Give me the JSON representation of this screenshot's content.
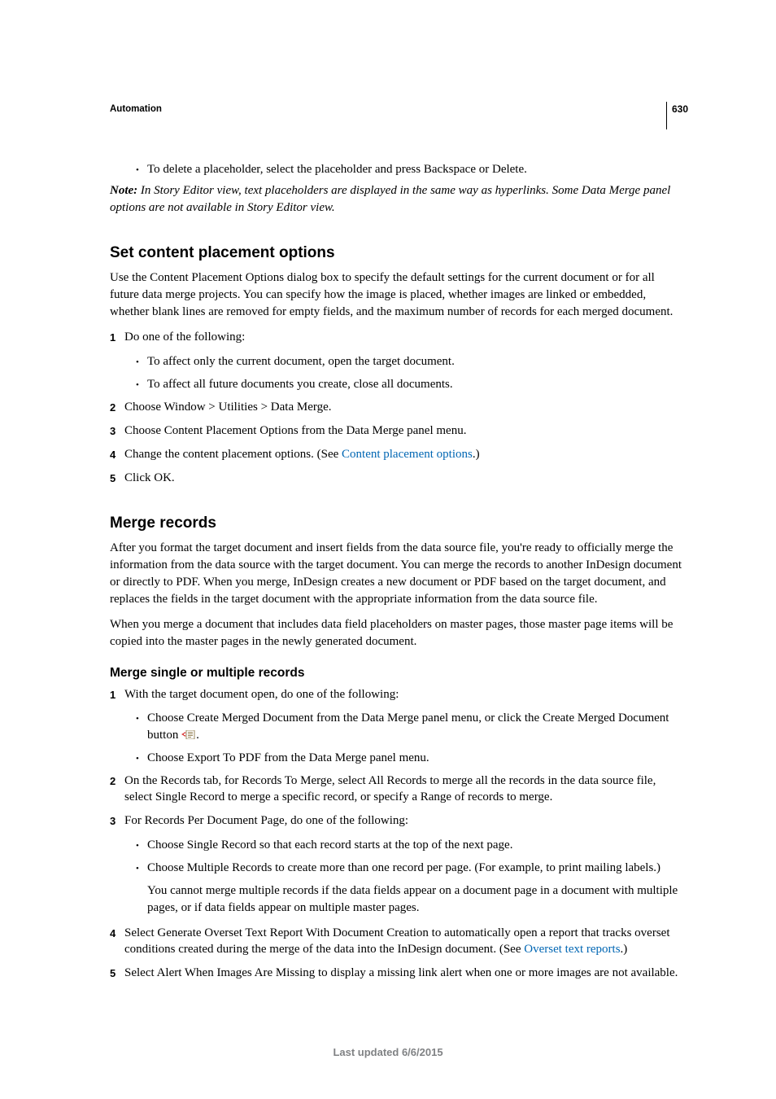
{
  "page_number": "630",
  "running_head": "Automation",
  "intro": {
    "bullet": "To delete a placeholder, select the placeholder and press Backspace or Delete.",
    "note_label": "Note: ",
    "note_text": "In Story Editor view, text placeholders are displayed in the same way as hyperlinks. Some Data Merge panel options are not available in Story Editor view."
  },
  "section1": {
    "title": "Set content placement options",
    "intro": "Use the Content Placement Options dialog box to specify the default settings for the current document or for all future data merge projects. You can specify how the image is placed, whether images are linked or embedded, whether blank lines are removed for empty fields, and the maximum number of records for each merged document.",
    "steps": [
      {
        "num": "1",
        "text": "Do one of the following:",
        "sub": [
          "To affect only the current document, open the target document.",
          "To affect all future documents you create, close all documents."
        ]
      },
      {
        "num": "2",
        "text": "Choose Window > Utilities > Data Merge."
      },
      {
        "num": "3",
        "text": "Choose Content Placement Options from the Data Merge panel menu."
      },
      {
        "num": "4",
        "text_pre": "Change the content placement options. (See ",
        "link": "Content placement options",
        "text_post": ".)"
      },
      {
        "num": "5",
        "text": "Click OK."
      }
    ]
  },
  "section2": {
    "title": "Merge records",
    "para1": "After you format the target document and insert fields from the data source file, you're ready to officially merge the information from the data source with the target document. You can merge the records to another InDesign document or directly to PDF. When you merge, InDesign creates a new document or PDF based on the target document, and replaces the fields in the target document with the appropriate information from the data source file.",
    "para2": "When you merge a document that includes data field placeholders on master pages, those master page items will be copied into the master pages in the newly generated document.",
    "sub_title": "Merge single or multiple records",
    "steps": [
      {
        "num": "1",
        "text": "With the target document open, do one of the following:",
        "sub": [
          {
            "pre": "Choose Create Merged Document from the Data Merge panel menu, or click the Create Merged Document button ",
            "has_icon": true,
            "post": "."
          },
          {
            "pre": "Choose Export To PDF from the Data Merge panel menu."
          }
        ]
      },
      {
        "num": "2",
        "text": "On the Records tab, for Records To Merge, select All Records to merge all the records in the data source file, select Single Record to merge a specific record, or specify a Range of records to merge."
      },
      {
        "num": "3",
        "text": "For Records Per Document Page, do one of the following:",
        "sub": [
          {
            "pre": "Choose Single Record so that each record starts at the top of the next page."
          },
          {
            "pre": "Choose Multiple Records to create more than one record per page. (For example, to print mailing labels.)"
          }
        ],
        "tail": "You cannot merge multiple records if the data fields appear on a document page in a document with multiple pages, or if data fields appear on multiple master pages."
      },
      {
        "num": "4",
        "text_pre": "Select Generate Overset Text Report With Document Creation to automatically open a report that tracks overset conditions created during the merge of the data into the InDesign document. (See ",
        "link": "Overset text reports",
        "text_post": ".)"
      },
      {
        "num": "5",
        "text": "Select Alert When Images Are Missing to display a missing link alert when one or more images are not available."
      }
    ]
  },
  "footer": "Last updated 6/6/2015"
}
